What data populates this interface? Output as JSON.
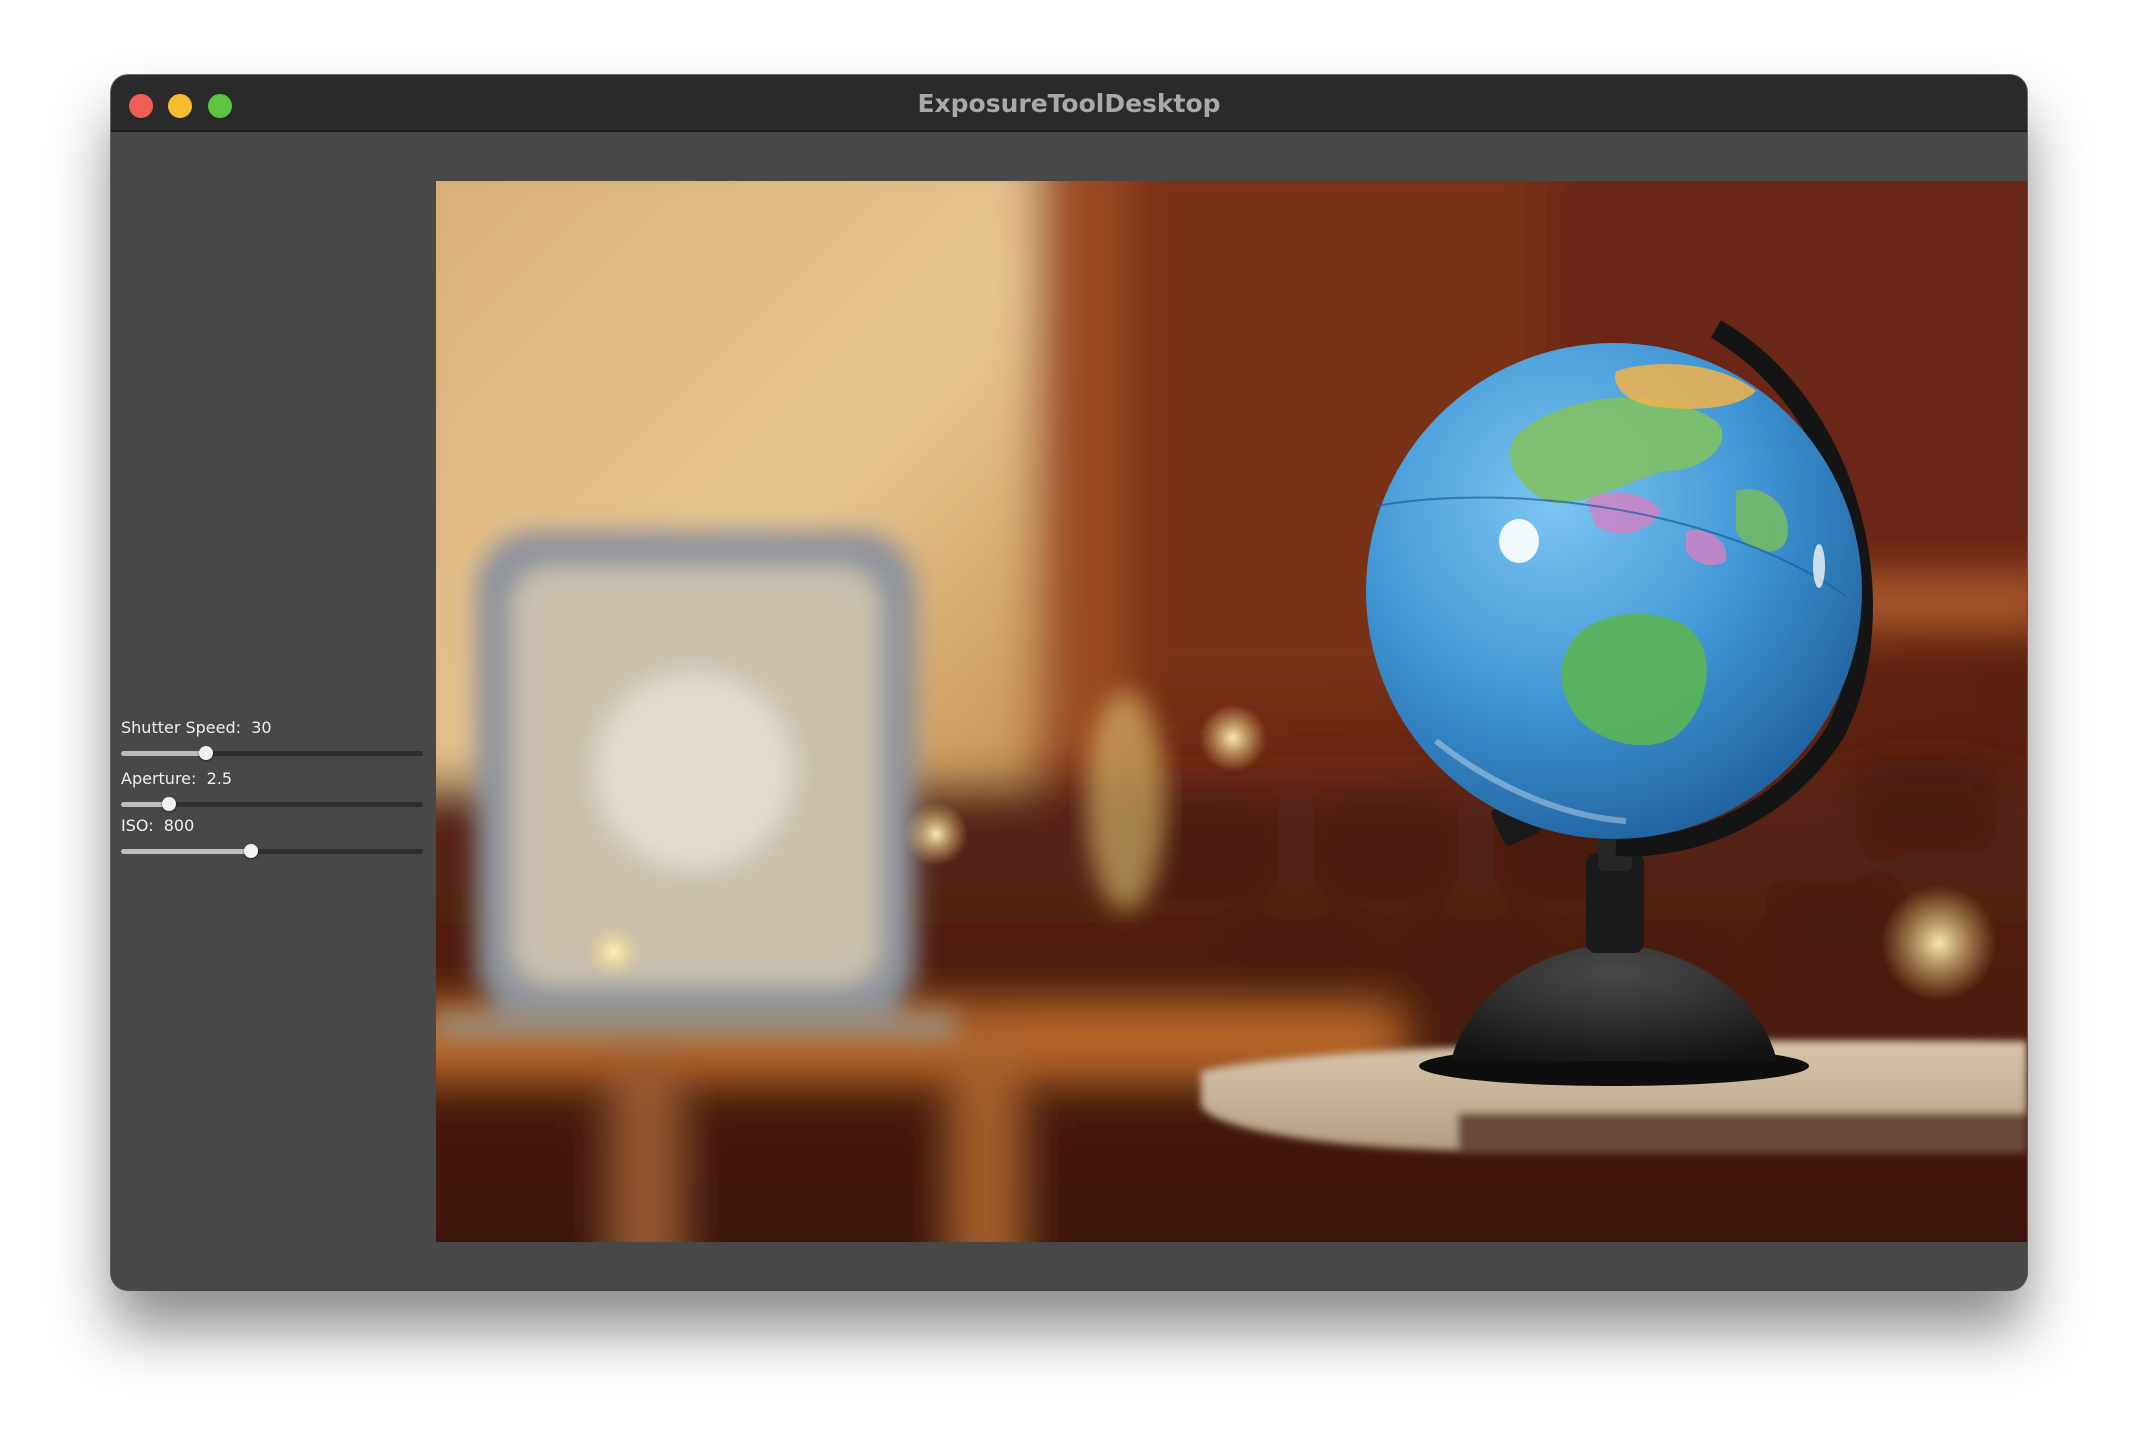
{
  "window": {
    "title": "ExposureToolDesktop",
    "traffic_lights": {
      "close": "#ee5e56",
      "minimize": "#f5bc2f",
      "zoom": "#5dc43f"
    }
  },
  "controls": {
    "shutter_speed": {
      "label": "Shutter Speed:",
      "value": "30",
      "position_fraction": 0.28
    },
    "aperture": {
      "label": "Aperture:",
      "value": "2.5",
      "position_fraction": 0.16
    },
    "iso": {
      "label": "ISO:",
      "value": "800",
      "position_fraction": 0.43
    }
  },
  "photo": {
    "subject": "globe-on-table",
    "colors": {
      "wall": "#d8b07a",
      "wood": "#7a2e18",
      "globe_ocean": "#3f95d4",
      "land": "#5ab25a",
      "stand": "#1a1a1a",
      "table": "#cdb99f"
    }
  }
}
